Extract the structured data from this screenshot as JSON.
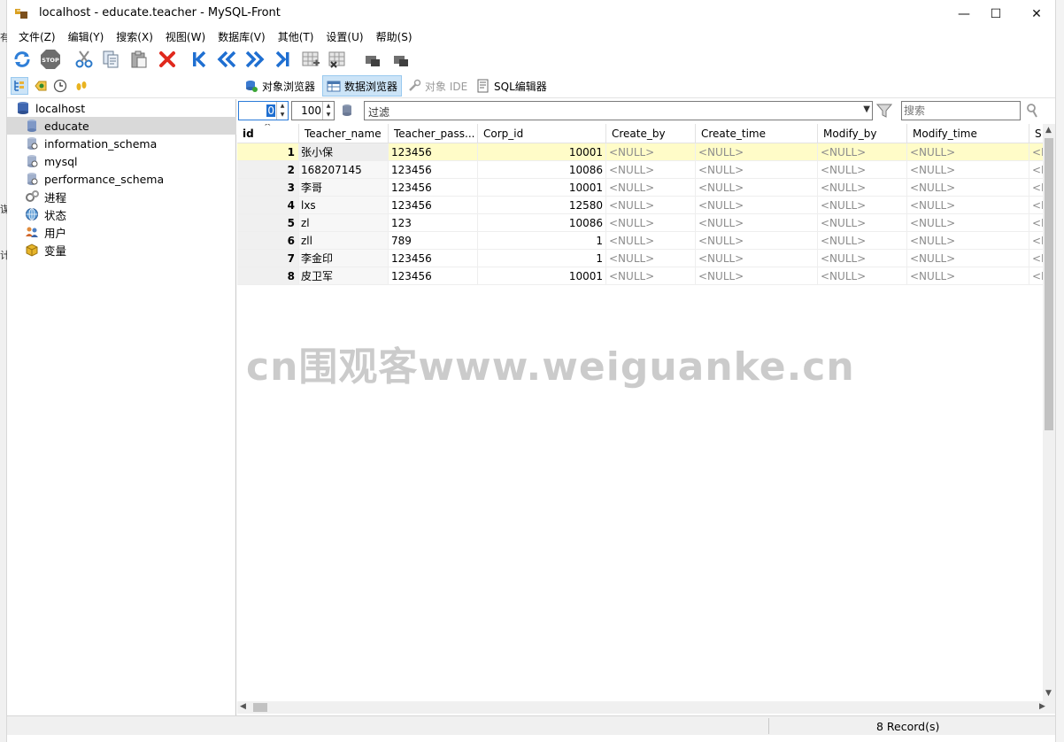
{
  "window": {
    "title": "localhost - educate.teacher - MySQL-Front",
    "minimize_glyph": "—",
    "maximize_glyph": "☐",
    "close_glyph": "✕"
  },
  "background_window": {
    "glyphs": [
      "有",
      "谋",
      "计"
    ]
  },
  "menu": {
    "items": [
      "文件(Z)",
      "编辑(Y)",
      "搜索(X)",
      "视图(W)",
      "数据库(V)",
      "其他(T)",
      "设置(U)",
      "帮助(S)"
    ]
  },
  "toolbar": {
    "icons": [
      "refresh-icon",
      "stop-icon",
      "cut-icon",
      "copy-icon",
      "paste-icon",
      "delete-icon",
      "first-record-icon",
      "previous-icon",
      "next-icon",
      "last-record-icon",
      "insert-record-icon",
      "delete-record-icon",
      "post-icon",
      "cancel-icon"
    ],
    "stop_label": "STOP"
  },
  "views": {
    "tabs": [
      {
        "label": "对象浏览器",
        "state": "normal"
      },
      {
        "label": "数据浏览器",
        "state": "active"
      },
      {
        "label": "对象 IDE",
        "state": "disabled"
      },
      {
        "label": "SQL编辑器",
        "state": "normal"
      }
    ]
  },
  "tree": {
    "items": [
      {
        "label": "localhost",
        "icon": "server-icon",
        "indent": 0,
        "selected": false
      },
      {
        "label": "educate",
        "icon": "database-icon",
        "indent": 1,
        "selected": true
      },
      {
        "label": "information_schema",
        "icon": "system-database-icon",
        "indent": 1,
        "selected": false
      },
      {
        "label": "mysql",
        "icon": "system-database-icon",
        "indent": 1,
        "selected": false
      },
      {
        "label": "performance_schema",
        "icon": "system-database-icon",
        "indent": 1,
        "selected": false
      },
      {
        "label": "进程",
        "icon": "processes-icon",
        "indent": 1,
        "selected": false
      },
      {
        "label": "状态",
        "icon": "status-globe-icon",
        "indent": 1,
        "selected": false
      },
      {
        "label": "用户",
        "icon": "users-icon",
        "indent": 1,
        "selected": false
      },
      {
        "label": "变量",
        "icon": "variables-icon",
        "indent": 1,
        "selected": false
      }
    ]
  },
  "filterbar": {
    "offset": "0",
    "limit": "100",
    "filter_placeholder": "过滤",
    "search_placeholder": "搜索"
  },
  "grid": {
    "columns": [
      "id",
      "Teacher_name",
      "Teacher_pass...",
      "Corp_id",
      "Create_by",
      "Create_time",
      "Modify_by",
      "Modify_time",
      "S"
    ],
    "sort_indicator": "^",
    "rows": [
      {
        "id": "1",
        "Teacher_name": "张小保",
        "Teacher_password": "123456",
        "Corp_id": "10001",
        "Create_by": "<NULL>",
        "Create_time": "<NULL>",
        "Modify_by": "<NULL>",
        "Modify_time": "<NULL>",
        "S": "<N"
      },
      {
        "id": "2",
        "Teacher_name": "168207145",
        "Teacher_password": "123456",
        "Corp_id": "10086",
        "Create_by": "<NULL>",
        "Create_time": "<NULL>",
        "Modify_by": "<NULL>",
        "Modify_time": "<NULL>",
        "S": "<N"
      },
      {
        "id": "3",
        "Teacher_name": "李哥",
        "Teacher_password": "123456",
        "Corp_id": "10001",
        "Create_by": "<NULL>",
        "Create_time": "<NULL>",
        "Modify_by": "<NULL>",
        "Modify_time": "<NULL>",
        "S": "<N"
      },
      {
        "id": "4",
        "Teacher_name": "lxs",
        "Teacher_password": "123456",
        "Corp_id": "12580",
        "Create_by": "<NULL>",
        "Create_time": "<NULL>",
        "Modify_by": "<NULL>",
        "Modify_time": "<NULL>",
        "S": "<N"
      },
      {
        "id": "5",
        "Teacher_name": "zl",
        "Teacher_password": "123",
        "Corp_id": "10086",
        "Create_by": "<NULL>",
        "Create_time": "<NULL>",
        "Modify_by": "<NULL>",
        "Modify_time": "<NULL>",
        "S": "<N"
      },
      {
        "id": "6",
        "Teacher_name": "zll",
        "Teacher_password": "789",
        "Corp_id": "1",
        "Create_by": "<NULL>",
        "Create_time": "<NULL>",
        "Modify_by": "<NULL>",
        "Modify_time": "<NULL>",
        "S": "<N"
      },
      {
        "id": "7",
        "Teacher_name": "李金印",
        "Teacher_password": "123456",
        "Corp_id": "1",
        "Create_by": "<NULL>",
        "Create_time": "<NULL>",
        "Modify_by": "<NULL>",
        "Modify_time": "<NULL>",
        "S": "<N"
      },
      {
        "id": "8",
        "Teacher_name": "皮卫军",
        "Teacher_password": "123456",
        "Corp_id": "10001",
        "Create_by": "<NULL>",
        "Create_time": "<NULL>",
        "Modify_by": "<NULL>",
        "Modify_time": "<NULL>",
        "S": "<N"
      }
    ]
  },
  "status": {
    "records": "8 Record(s)"
  },
  "watermark": {
    "text": "cn围观客www.weiguanke.cn"
  },
  "colors": {
    "selected_row": "#fffcc8",
    "null_text": "#8c8c8c",
    "active_tab": "#cce4f7",
    "nav_blue": "#1f6fd1",
    "delete_red": "#e0291d"
  }
}
